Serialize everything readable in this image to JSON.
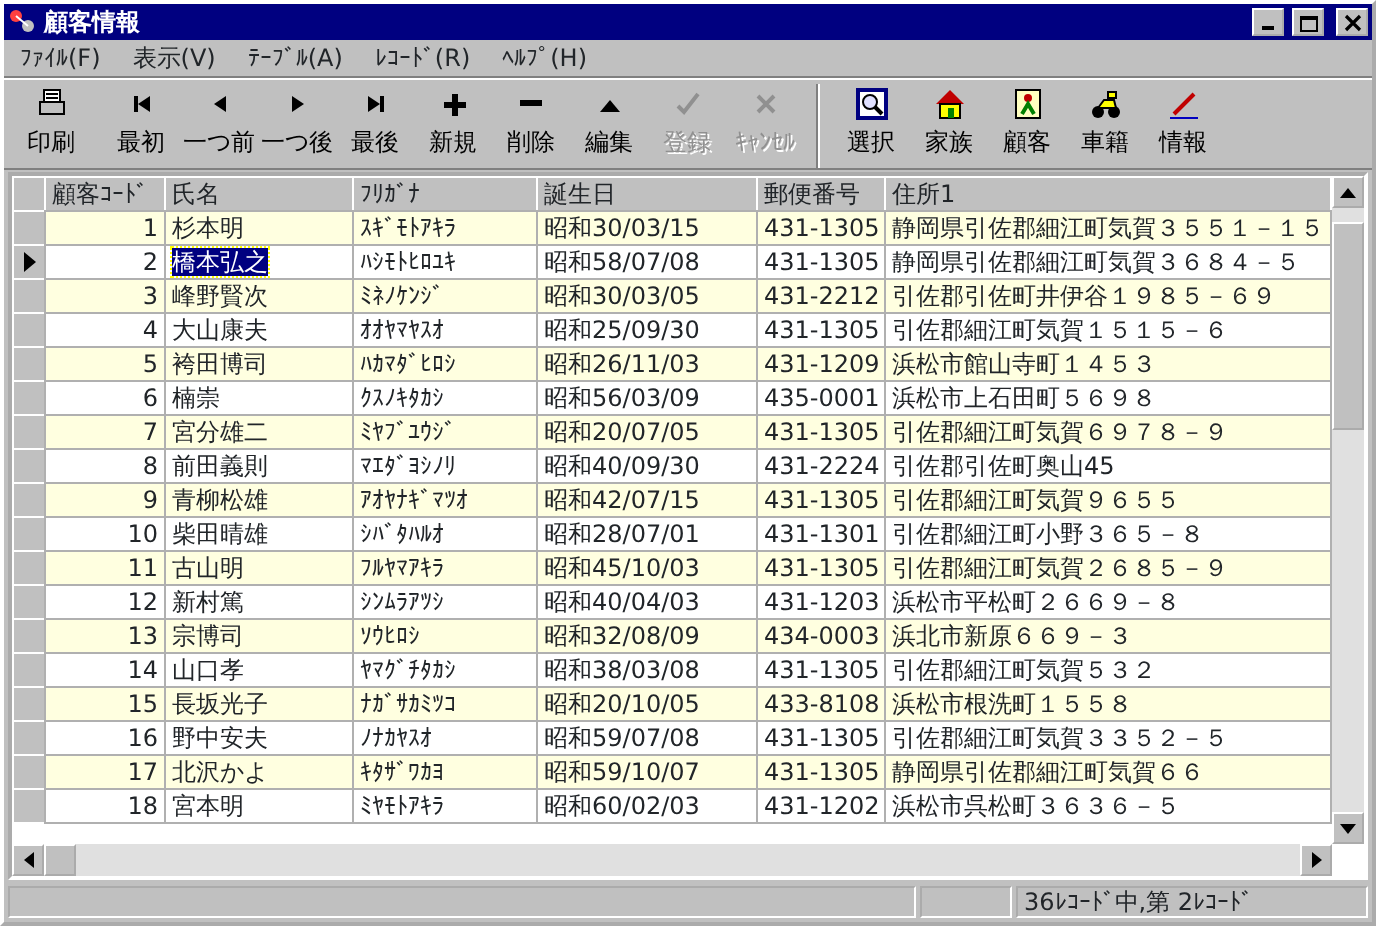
{
  "window": {
    "title": "顧客情報"
  },
  "menu": [
    "ﾌｧｲﾙ(F)",
    "表示(V)",
    "ﾃｰﾌﾞﾙ(A)",
    "ﾚｺｰﾄﾞ(R)",
    "ﾍﾙﾌﾟ(H)"
  ],
  "toolbar": [
    [
      {
        "label": "印刷",
        "kind": "print",
        "disabled": false
      }
    ],
    [
      {
        "label": "最初",
        "kind": "first",
        "disabled": false
      },
      {
        "label": "一つ前",
        "kind": "prev",
        "disabled": false
      },
      {
        "label": "一つ後",
        "kind": "next",
        "disabled": false
      },
      {
        "label": "最後",
        "kind": "last",
        "disabled": false
      },
      {
        "label": "新規",
        "kind": "plus",
        "disabled": false
      },
      {
        "label": "削除",
        "kind": "minus",
        "disabled": false
      },
      {
        "label": "編集",
        "kind": "up",
        "disabled": false
      },
      {
        "label": "登録",
        "kind": "check",
        "disabled": true
      },
      {
        "label": "ｷｬﾝｾﾙ",
        "kind": "cross",
        "disabled": true
      }
    ],
    [
      {
        "label": "選択",
        "kind": "search",
        "disabled": false
      },
      {
        "label": "家族",
        "kind": "house",
        "disabled": false
      },
      {
        "label": "顧客",
        "kind": "person",
        "disabled": false
      },
      {
        "label": "車籍",
        "kind": "bike",
        "disabled": false
      },
      {
        "label": "情報",
        "kind": "pencil",
        "disabled": false
      }
    ]
  ],
  "table": {
    "columns": [
      "顧客ｺｰﾄﾞ",
      "氏名",
      "ﾌﾘｶﾞﾅ",
      "誕生日",
      "郵便番号",
      "住所1"
    ],
    "rows": [
      {
        "cells": [
          "1",
          "杉本明",
          "ｽｷﾞﾓﾄｱｷﾗ",
          "昭和30/03/15",
          "431-1305",
          "静岡県引佐郡細江町気賀３５５１－１５"
        ],
        "selected": false
      },
      {
        "cells": [
          "2",
          "橋本弘之",
          "ﾊｼﾓﾄﾋﾛﾕｷ",
          "昭和58/07/08",
          "431-1305",
          "静岡県引佐郡細江町気賀３６８４－５"
        ],
        "selected": true
      },
      {
        "cells": [
          "3",
          "峰野賢次",
          "ﾐﾈﾉｹﾝｼﾞ",
          "昭和30/03/05",
          "431-2212",
          "引佐郡引佐町井伊谷１９８５－６９"
        ],
        "selected": false
      },
      {
        "cells": [
          "4",
          "大山康夫",
          "ｵｵﾔﾏﾔｽｵ",
          "昭和25/09/30",
          "431-1305",
          "引佐郡細江町気賀１５１５－６"
        ],
        "selected": false
      },
      {
        "cells": [
          "5",
          "袴田博司",
          "ﾊｶﾏﾀﾞﾋﾛｼ",
          "昭和26/11/03",
          "431-1209",
          "浜松市館山寺町１４５３"
        ],
        "selected": false
      },
      {
        "cells": [
          "6",
          "楠崇",
          "ｸｽﾉｷﾀｶｼ",
          "昭和56/03/09",
          "435-0001",
          "浜松市上石田町５６９８"
        ],
        "selected": false
      },
      {
        "cells": [
          "7",
          "宮分雄二",
          "ﾐﾔﾌﾞﾕｳｼﾞ",
          "昭和20/07/05",
          "431-1305",
          "引佐郡細江町気賀６９７８－９"
        ],
        "selected": false
      },
      {
        "cells": [
          "8",
          "前田義則",
          "ﾏｴﾀﾞﾖｼﾉﾘ",
          "昭和40/09/30",
          "431-2224",
          "引佐郡引佐町奥山45"
        ],
        "selected": false
      },
      {
        "cells": [
          "9",
          "青柳松雄",
          "ｱｵﾔﾅｷﾞﾏﾂｵ",
          "昭和42/07/15",
          "431-1305",
          "引佐郡細江町気賀９６５５"
        ],
        "selected": false
      },
      {
        "cells": [
          "10",
          "柴田晴雄",
          "ｼﾊﾞﾀﾊﾙｵ",
          "昭和28/07/01",
          "431-1301",
          "引佐郡細江町小野３６５－８"
        ],
        "selected": false
      },
      {
        "cells": [
          "11",
          "古山明",
          "ﾌﾙﾔﾏｱｷﾗ",
          "昭和45/10/03",
          "431-1305",
          "引佐郡細江町気賀２６８５－９"
        ],
        "selected": false
      },
      {
        "cells": [
          "12",
          "新村篤",
          "ｼﾝﾑﾗｱﾂｼ",
          "昭和40/04/03",
          "431-1203",
          "浜松市平松町２６６９－８"
        ],
        "selected": false
      },
      {
        "cells": [
          "13",
          "宗博司",
          "ｿｳﾋﾛｼ",
          "昭和32/08/09",
          "434-0003",
          "浜北市新原６６９－３"
        ],
        "selected": false
      },
      {
        "cells": [
          "14",
          "山口孝",
          "ﾔﾏｸﾞﾁﾀｶｼ",
          "昭和38/03/08",
          "431-1305",
          "引佐郡細江町気賀５３２"
        ],
        "selected": false
      },
      {
        "cells": [
          "15",
          "長坂光子",
          "ﾅｶﾞｻｶﾐﾂｺ",
          "昭和20/10/05",
          "433-8108",
          "浜松市根洗町１５５８"
        ],
        "selected": false
      },
      {
        "cells": [
          "16",
          "野中安夫",
          "ﾉﾅｶﾔｽｵ",
          "昭和59/07/08",
          "431-1305",
          "引佐郡細江町気賀３３５２－５"
        ],
        "selected": false
      },
      {
        "cells": [
          "17",
          "北沢かよ",
          "ｷﾀｻﾞﾜｶﾖ",
          "昭和59/10/07",
          "431-1305",
          "静岡県引佐郡細江町気賀６６"
        ],
        "selected": false
      },
      {
        "cells": [
          "18",
          "宮本明",
          "ﾐﾔﾓﾄｱｷﾗ",
          "昭和60/02/03",
          "431-1202",
          "浜松市呉松町３６３６－５"
        ],
        "selected": false
      }
    ]
  },
  "status_bar": {
    "text": "36ﾚｺｰﾄﾞ中,第 2ﾚｺｰﾄﾞ"
  }
}
